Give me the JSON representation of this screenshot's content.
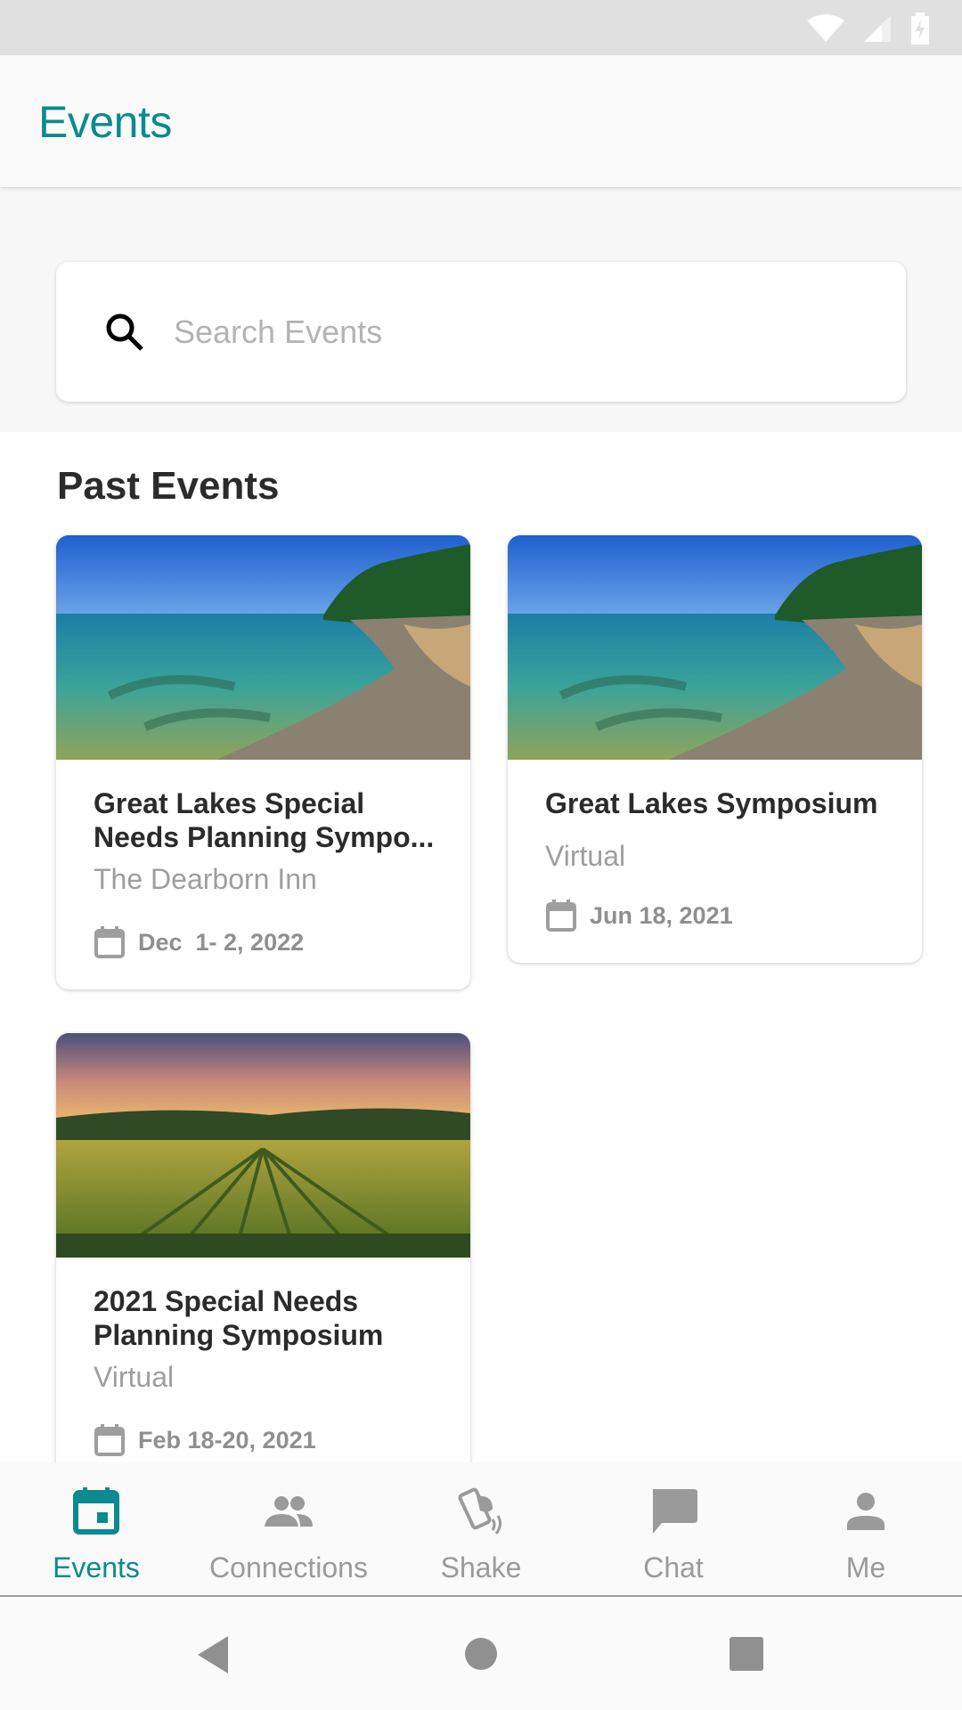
{
  "colors": {
    "accent": "#0b8a8f",
    "inactive": "#9a9a9a",
    "title_text": "#2b2b2b",
    "secondary_text": "#9e9e9e"
  },
  "status_bar": {
    "icons": [
      "wifi-icon",
      "cell-signal-icon",
      "battery-charging-icon"
    ]
  },
  "header": {
    "title": "Events"
  },
  "search": {
    "placeholder": "Search Events",
    "value": ""
  },
  "section": {
    "title": "Past Events"
  },
  "events": [
    {
      "title": "Great Lakes Special Needs Planning Sympo...",
      "location": "The Dearborn Inn",
      "date": "Dec  1- 2, 2022",
      "image": "lake-shoreline"
    },
    {
      "title": "Great Lakes Symposium",
      "location": "Virtual",
      "date": "Jun 18, 2021",
      "image": "lake-shoreline"
    },
    {
      "title": "2021 Special Needs Planning Symposium",
      "location": "Virtual",
      "date": "Feb 18-20, 2021",
      "image": "vineyard-sunset"
    }
  ],
  "bottom_nav": {
    "active": "Events",
    "items": [
      {
        "label": "Events",
        "icon": "calendar-icon"
      },
      {
        "label": "Connections",
        "icon": "people-icon"
      },
      {
        "label": "Shake",
        "icon": "shake-phone-icon"
      },
      {
        "label": "Chat",
        "icon": "chat-icon"
      },
      {
        "label": "Me",
        "icon": "person-icon"
      }
    ]
  },
  "system_nav": {
    "buttons": [
      "back",
      "home",
      "recents"
    ]
  }
}
